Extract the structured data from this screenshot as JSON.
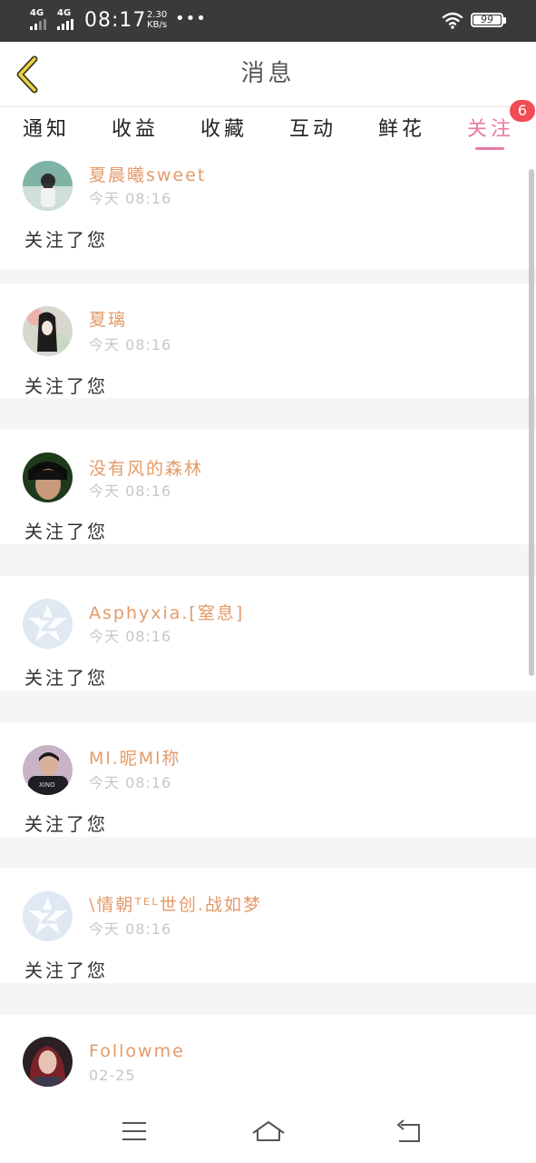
{
  "status_bar": {
    "sim1": "4G",
    "sim2": "4G",
    "time": "08:17",
    "net_speed_value": "2.30",
    "net_speed_unit": "KB/s",
    "more": "•••",
    "battery": "99"
  },
  "header": {
    "title": "消息"
  },
  "tabs": [
    {
      "label": "通知",
      "active": false
    },
    {
      "label": "收益",
      "active": false
    },
    {
      "label": "收藏",
      "active": false
    },
    {
      "label": "互动",
      "active": false
    },
    {
      "label": "鲜花",
      "active": false
    },
    {
      "label": "关注",
      "active": true,
      "badge": "6"
    }
  ],
  "feed": [
    {
      "name": "夏晨曦sweet",
      "time": "今天 08:16",
      "message": "关注了您",
      "avatar": "photo-girl-camera"
    },
    {
      "name": "夏璃",
      "time": "今天 08:16",
      "message": "关注了您",
      "avatar": "photo-girl-hair"
    },
    {
      "name": "没有风的森林",
      "time": "今天 08:16",
      "message": "关注了您",
      "avatar": "photo-boy-face"
    },
    {
      "name": "Asphyxia.[窒息]",
      "time": "今天 08:16",
      "message": "关注了您",
      "avatar": "default-z"
    },
    {
      "name": "Ml.昵Ml称",
      "time": "今天 08:16",
      "message": "关注了您",
      "avatar": "photo-boy-shirt"
    },
    {
      "name": "\\情朝ᵀᴱᴸ世创.战如梦",
      "time": "今天 08:16",
      "message": "关注了您",
      "avatar": "default-z"
    },
    {
      "name": "Followme",
      "time": "02-25",
      "message": "",
      "avatar": "photo-girl-red"
    }
  ],
  "navbar": {
    "items": [
      "menu-icon",
      "home-icon",
      "back-icon"
    ]
  }
}
